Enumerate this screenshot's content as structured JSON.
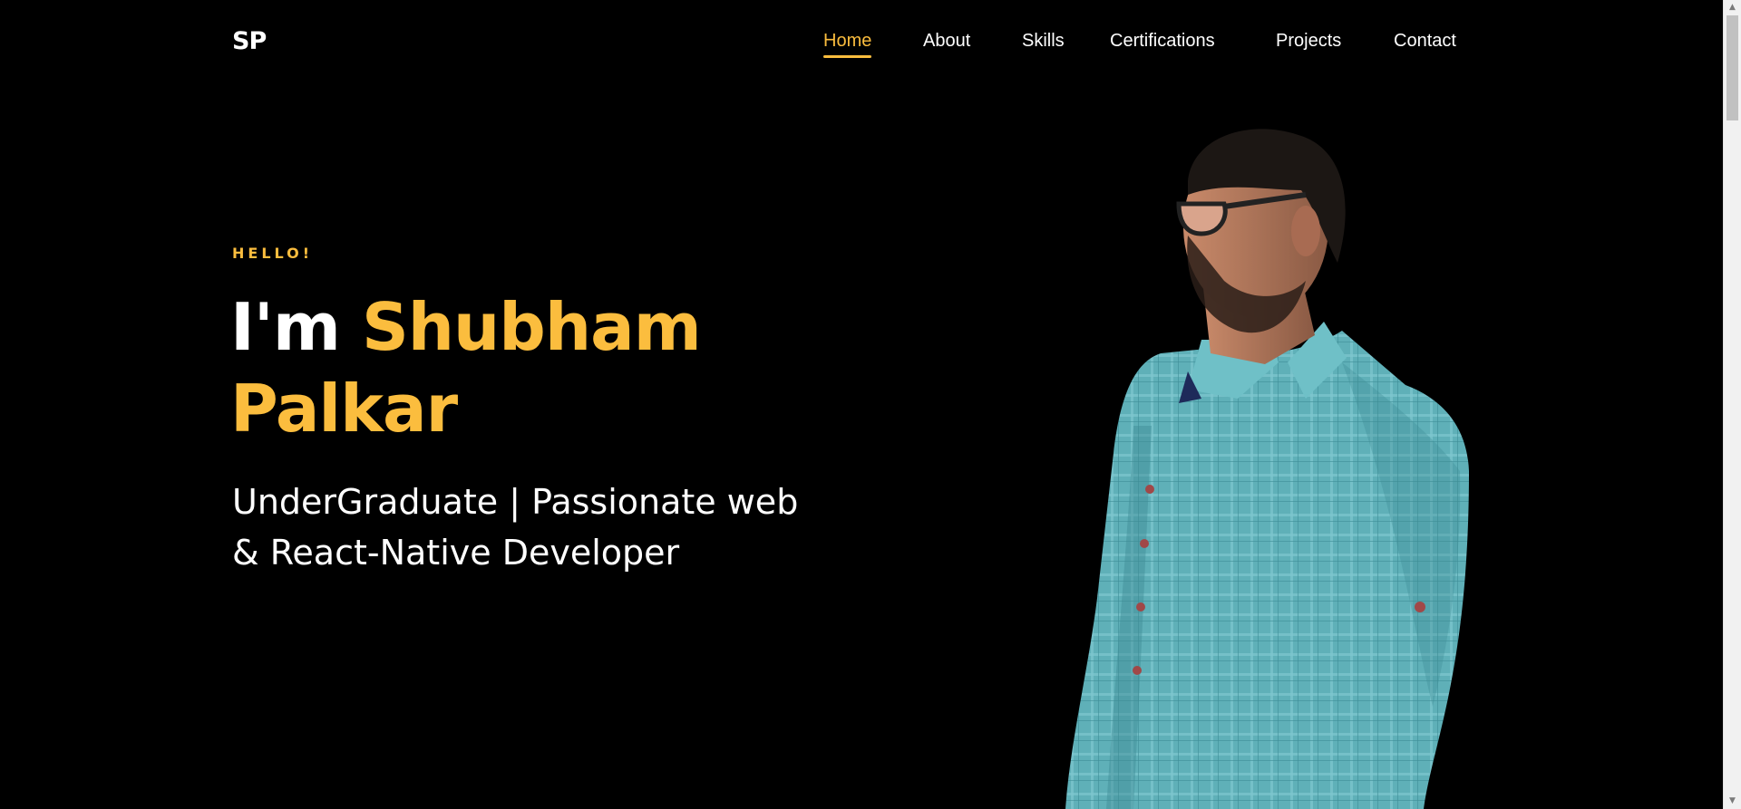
{
  "header": {
    "logo": "SP",
    "nav": [
      {
        "label": "Home",
        "active": true
      },
      {
        "label": "About",
        "active": false
      },
      {
        "label": "Skills",
        "active": false
      },
      {
        "label": "Certifications",
        "active": false
      },
      {
        "label": "Projects",
        "active": false
      },
      {
        "label": "Contact",
        "active": false
      }
    ]
  },
  "hero": {
    "greeting": "HELLO!",
    "intro": "I'm",
    "name": "Shubham Palkar",
    "subtitle": "UnderGraduate | Passionate web & React-Native Developer",
    "portrait": "person-portrait"
  },
  "colors": {
    "accent": "#fbbd3e",
    "background": "#000000",
    "text": "#ffffff",
    "shirt": "#5fb6bf"
  },
  "icons": {
    "scroll_up": "chevron-up-icon",
    "scroll_down": "chevron-down-icon"
  }
}
